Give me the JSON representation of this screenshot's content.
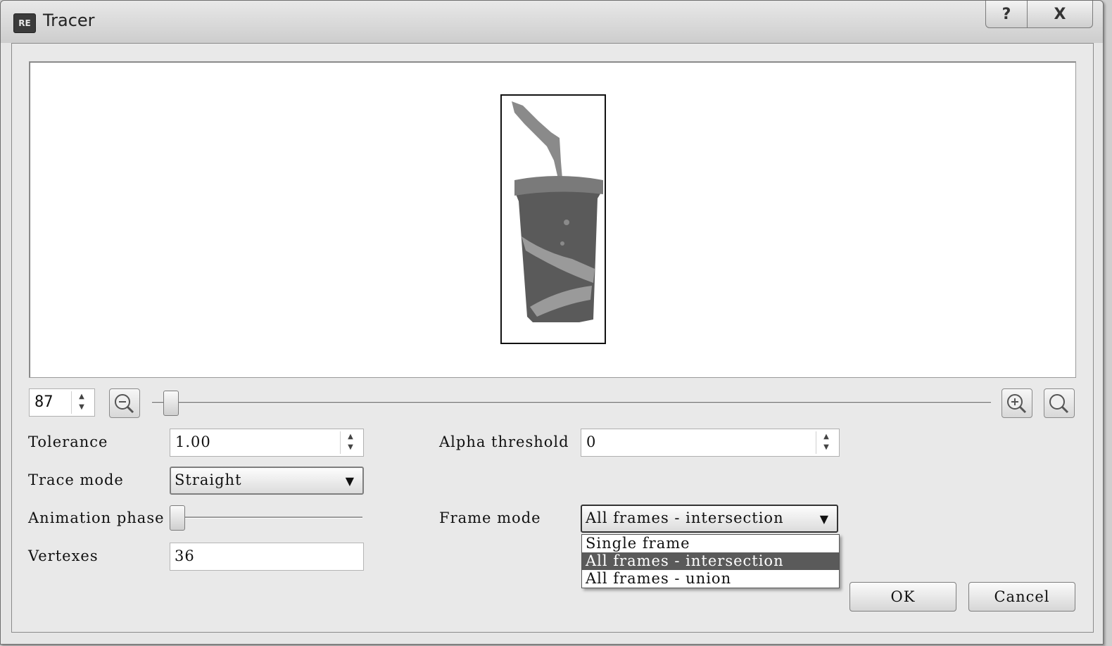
{
  "window": {
    "title": "Tracer",
    "help_label": "?",
    "close_label": "X"
  },
  "zoom": {
    "value": "87"
  },
  "form": {
    "tolerance_label": "Tolerance",
    "tolerance_value": "1.00",
    "alpha_threshold_label": "Alpha threshold",
    "alpha_threshold_value": "0",
    "trace_mode_label": "Trace mode",
    "trace_mode_value": "Straight",
    "animation_phase_label": "Animation phase",
    "animation_phase_level": 0,
    "frame_mode_label": "Frame mode",
    "frame_mode_value": "All frames - intersection",
    "frame_mode_options": [
      "Single frame",
      "All frames - intersection",
      "All frames - union"
    ],
    "vertexes_label": "Vertexes",
    "vertexes_value": "36"
  },
  "buttons": {
    "ok": "OK",
    "cancel": "Cancel"
  }
}
